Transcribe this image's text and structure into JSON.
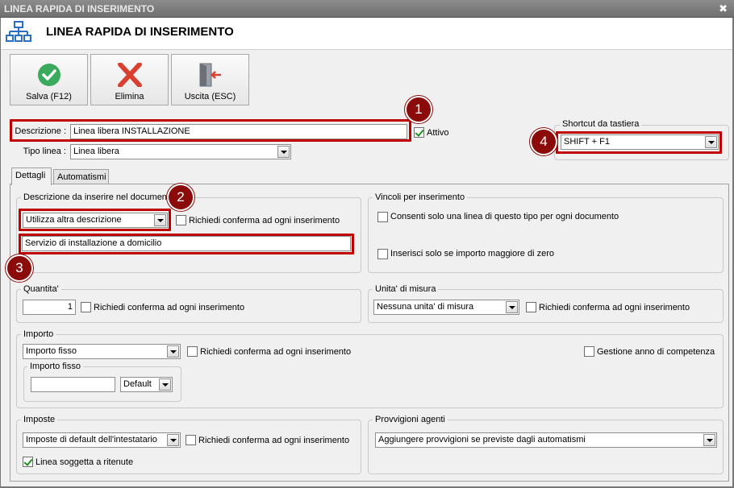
{
  "window": {
    "title": "LINEA RAPIDA DI INSERIMENTO",
    "close_glyph": "✖"
  },
  "header": {
    "title": "LINEA RAPIDA DI INSERIMENTO",
    "icon": "sitemap-icon"
  },
  "toolbar": {
    "save_label": "Salva (F12)",
    "delete_label": "Elimina",
    "exit_label": "Uscita (ESC)"
  },
  "form": {
    "descrizione_label": "Descrizione :",
    "descrizione_value": "Linea libera INSTALLAZIONE",
    "attivo_label": "Attivo",
    "attivo_checked": true,
    "tipo_linea_label": "Tipo linea :",
    "tipo_linea_value": "Linea libera"
  },
  "shortcut": {
    "legend": "Shortcut da tastiera",
    "value": "SHIFT + F1"
  },
  "tabs": [
    {
      "label": "Dettagli",
      "active": true
    },
    {
      "label": "Automatismi",
      "active": false
    }
  ],
  "descrizione_group": {
    "legend": "Descrizione da inserire nel documento",
    "select_value": "Utilizza altra descrizione",
    "confirm_label": "Richiedi conferma ad ogni inserimento",
    "text_value": "Servizio di installazione a domicilio"
  },
  "vincoli": {
    "legend": "Vincoli per inserimento",
    "option1": "Consenti solo una linea di questo tipo per ogni documento",
    "option2": "Inserisci solo se importo maggiore di zero"
  },
  "quantita": {
    "legend": "Quantita'",
    "value": "1",
    "confirm_label": "Richiedi conferma ad ogni inserimento"
  },
  "unita": {
    "legend": "Unita' di misura",
    "select_value": "Nessuna unita' di misura",
    "confirm_label": "Richiedi conferma ad ogni inserimento"
  },
  "importo": {
    "legend": "Importo",
    "select_value": "Importo fisso",
    "confirm_label": "Richiedi conferma ad ogni inserimento",
    "gestione_label": "Gestione anno di competenza",
    "fisso_legend": "Importo fisso",
    "fisso_value": "",
    "fisso_select": "Default"
  },
  "imposte": {
    "legend": "Imposte",
    "select_value": "Imposte di default dell'intestatario",
    "confirm_label": "Richiedi conferma ad ogni inserimento",
    "ritenute_label": "Linea soggetta a ritenute",
    "ritenute_checked": true
  },
  "provvigioni": {
    "legend": "Provvigioni agenti",
    "select_value": "Aggiungere provvigioni se previste dagli automatismi"
  },
  "badges": [
    "1",
    "2",
    "3",
    "4"
  ],
  "colors": {
    "highlight": "#c00000",
    "badge": "#8b0a0a",
    "save_green": "#3aaa5c",
    "delete_red": "#d9402f"
  }
}
